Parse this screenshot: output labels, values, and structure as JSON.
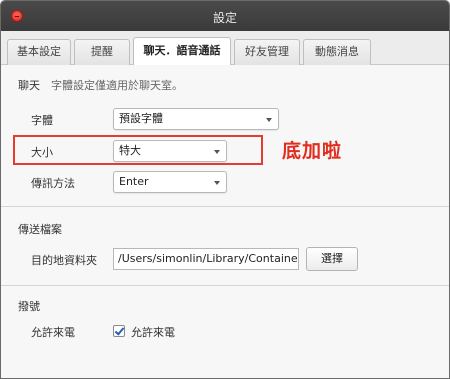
{
  "window": {
    "title": "設定"
  },
  "tabs": [
    {
      "label": "基本設定",
      "active": false
    },
    {
      "label": "提醒",
      "active": false
    },
    {
      "label": "聊天．語音通話",
      "active": true
    },
    {
      "label": "好友管理",
      "active": false
    },
    {
      "label": "動態消息",
      "active": false
    }
  ],
  "chat": {
    "heading": "聊天",
    "hint": "字體設定僅適用於聊天室。",
    "font_label": "字體",
    "font_value": "預設字體",
    "size_label": "大小",
    "size_value": "特大",
    "send_label": "傳訊方法",
    "send_value": "Enter"
  },
  "annotation": {
    "text": "底加啦",
    "color": "#e02d1f"
  },
  "transfer": {
    "heading": "傳送檔案",
    "folder_label": "目的地資料夾",
    "folder_path": "/Users/simonlin/Library/Containers",
    "choose_button": "選擇"
  },
  "calls": {
    "heading": "撥號",
    "allow_label": "允許來電",
    "checkbox_label": "允許來電",
    "checked": true
  }
}
